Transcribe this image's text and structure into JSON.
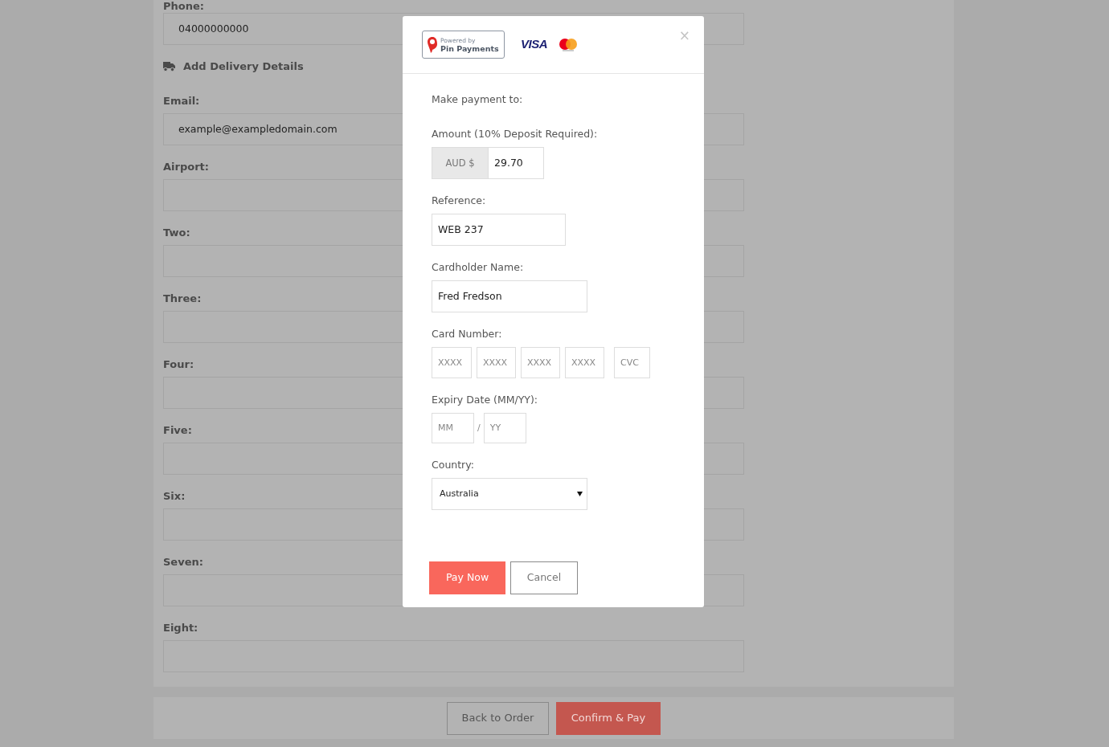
{
  "order_form": {
    "phone": {
      "label": "Phone:",
      "value": "04000000000"
    },
    "delivery_heading": "Add Delivery Details",
    "fields": [
      {
        "label": "Email:",
        "value": "example@exampledomain.com"
      },
      {
        "label": "Airport:"
      },
      {
        "label": "Two:"
      },
      {
        "label": "Three:"
      },
      {
        "label": "Four:"
      },
      {
        "label": "Five:"
      },
      {
        "label": "Six:"
      },
      {
        "label": "Seven:"
      },
      {
        "label": "Eight:"
      }
    ]
  },
  "footer": {
    "buttons": [
      {
        "label": "Back to Order",
        "kind": "outline"
      },
      {
        "label": "Confirm & Pay",
        "kind": "primary"
      }
    ]
  },
  "payment_modal": {
    "logo": {
      "powered_by": "Powered by",
      "brand": "Pin Payments"
    },
    "card_brand": "VISA",
    "close": "×",
    "payment_to_label": "Make payment to:",
    "amount": {
      "label": "Amount (10% Deposit Required):",
      "currency": "AUD $",
      "value": "29.70"
    },
    "reference": {
      "label": "Reference:",
      "value": "WEB 237"
    },
    "cardholder": {
      "label": "Cardholder Name:",
      "value": "Fred Fredson"
    },
    "card_number": {
      "label": "Card Number:",
      "placeholders": [
        "XXXX",
        "XXXX",
        "XXXX",
        "XXXX"
      ],
      "cvc_placeholder": "CVC"
    },
    "expiry": {
      "label": "Expiry Date (MM/YY):",
      "month_placeholder": "MM",
      "separator": "/",
      "year_placeholder": "YY"
    },
    "country": {
      "label": "Country:",
      "value": "Australia"
    },
    "buttons": [
      {
        "label": "Pay Now",
        "kind": "primary"
      },
      {
        "label": "Cancel",
        "kind": "outline"
      }
    ]
  }
}
